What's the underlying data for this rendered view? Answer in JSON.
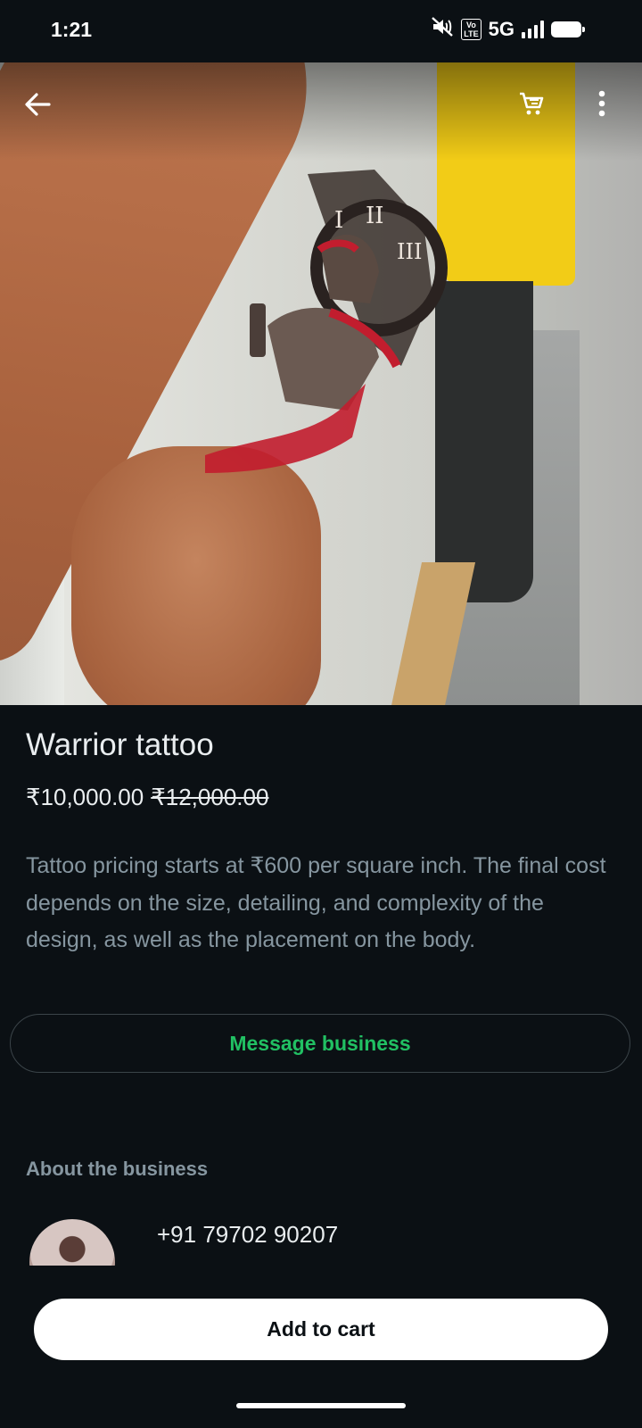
{
  "status_bar": {
    "time": "1:21",
    "volte_top": "Vo",
    "volte_bottom": "LTE",
    "network": "5G",
    "icons": [
      "mute-icon",
      "volte-icon",
      "signal-icon",
      "battery-icon"
    ]
  },
  "header": {
    "icons": [
      "back-arrow-icon",
      "cart-icon",
      "more-vertical-icon"
    ]
  },
  "product": {
    "title": "Warrior tattoo",
    "price": "₹10,000.00",
    "original_price": "₹12,000.00",
    "description": "Tattoo pricing starts at ₹600 per square inch. The final cost depends on the size, detailing, and complexity of the design, as well as the placement on the body."
  },
  "actions": {
    "message_label": "Message business",
    "add_to_cart_label": "Add to cart"
  },
  "business": {
    "heading": "About the business",
    "phone": "+91 79702 90207"
  },
  "colors": {
    "background": "#0b1014",
    "accent_green": "#21c063",
    "muted_text": "#8696a0"
  }
}
